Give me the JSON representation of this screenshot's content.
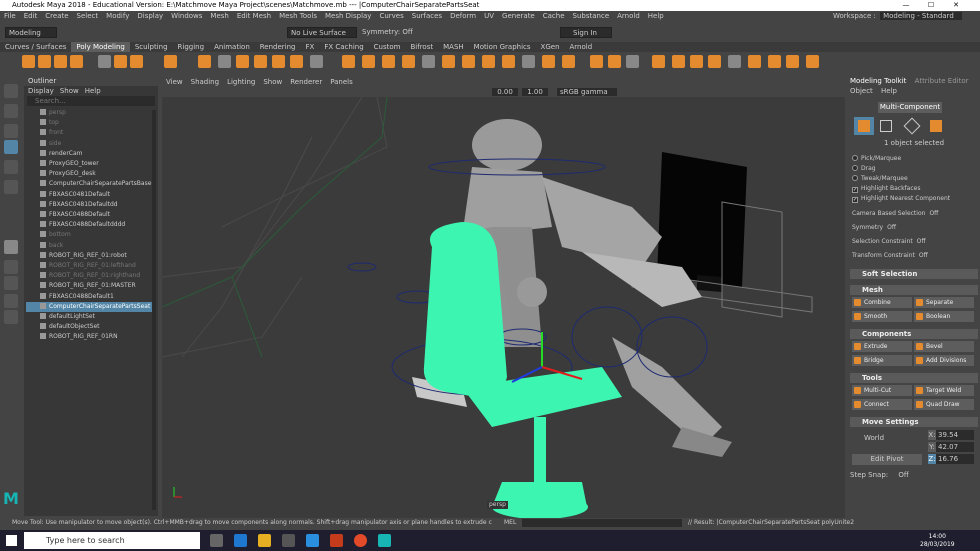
{
  "title": "Autodesk Maya 2018 - Educational Version: E:\\Matchmove Maya Project\\scenes\\Matchmove.mb  ---  |ComputerChairSeparatePartsSeat",
  "window_controls": [
    "—",
    "☐",
    "✕"
  ],
  "menus": [
    "File",
    "Edit",
    "Create",
    "Select",
    "Modify",
    "Display",
    "Windows",
    "Mesh",
    "Edit Mesh",
    "Mesh Tools",
    "Mesh Display",
    "Curves",
    "Surfaces",
    "Deform",
    "UV",
    "Generate",
    "Cache",
    "Substance",
    "Arnold",
    "Help"
  ],
  "workspace_label": "Workspace :",
  "workspace_value": "Modeling - Standard",
  "menuset": "Modeling",
  "live_surface": "No Live Surface",
  "symmetry": "Symmetry: Off",
  "sign_in": "Sign In",
  "shelf_tabs": [
    "Curves / Surfaces",
    "Poly Modeling",
    "Sculpting",
    "Rigging",
    "Animation",
    "Rendering",
    "FX",
    "FX Caching",
    "Custom",
    "Bifrost",
    "MASH",
    "Motion Graphics",
    "XGen",
    "Arnold"
  ],
  "shelf_active": "Poly Modeling",
  "outliner": {
    "title": "Outliner",
    "menu": [
      "Display",
      "Show",
      "Help"
    ],
    "search_placeholder": "Search...",
    "items": [
      {
        "label": "persp",
        "dim": true
      },
      {
        "label": "top",
        "dim": true
      },
      {
        "label": "front",
        "dim": true
      },
      {
        "label": "side",
        "dim": true
      },
      {
        "label": "renderCam",
        "dim": false
      },
      {
        "label": "ProxyGEO_tower",
        "dim": false
      },
      {
        "label": "ProxyGEO_desk",
        "dim": false
      },
      {
        "label": "ComputerChairSeparatePartsBase",
        "dim": false
      },
      {
        "label": "FBXASC0481Default",
        "dim": false
      },
      {
        "label": "FBXASC0481Defaultdd",
        "dim": false
      },
      {
        "label": "FBXASC0488Default",
        "dim": false
      },
      {
        "label": "FBXASC0488Defaultdddd",
        "dim": false
      },
      {
        "label": "bottom",
        "dim": true
      },
      {
        "label": "back",
        "dim": true
      },
      {
        "label": "ROBOT_RIG_REF_01:robot",
        "dim": false
      },
      {
        "label": "ROBOT_RIG_REF_01:lefthand",
        "dim": true
      },
      {
        "label": "ROBOT_RIG_REF_01:righthand",
        "dim": true
      },
      {
        "label": "ROBOT_RIG_REF_01:MASTER",
        "dim": false
      },
      {
        "label": "FBXASC0488Default1",
        "dim": false
      },
      {
        "label": "ComputerChairSeparatePartsSeat",
        "dim": false,
        "selected": true
      },
      {
        "label": "defaultLightSet",
        "dim": false
      },
      {
        "label": "defaultObjectSet",
        "dim": false
      },
      {
        "label": "ROBOT_RIG_REF_01RN",
        "dim": false
      }
    ]
  },
  "viewport": {
    "menu": [
      "View",
      "Shading",
      "Lighting",
      "Show",
      "Renderer",
      "Panels"
    ],
    "val1": "0.00",
    "val2": "1.00",
    "colorspace": "sRGB gamma",
    "camera_label": "persp"
  },
  "toolkit": {
    "tabs": [
      "Modeling Toolkit",
      "Attribute Editor"
    ],
    "menu": [
      "Object",
      "Help"
    ],
    "mode": "Multi-Component",
    "selected_info": "1 object selected",
    "options": [
      {
        "label": "Pick/Marquee",
        "type": "radio"
      },
      {
        "label": "Drag",
        "type": "radio"
      },
      {
        "label": "Tweak/Marquee",
        "type": "radio"
      },
      {
        "label": "Highlight Backfaces",
        "type": "check"
      },
      {
        "label": "Highlight Nearest Component",
        "type": "check"
      }
    ],
    "settings": [
      {
        "label": "Camera Based Selection",
        "value": "Off"
      },
      {
        "label": "Symmetry",
        "value": "Off"
      },
      {
        "label": "Selection Constraint",
        "value": "Off"
      },
      {
        "label": "Transform Constraint",
        "value": "Off"
      }
    ],
    "soft_selection": "Soft Selection",
    "mesh_header": "Mesh",
    "mesh_buttons": [
      "Combine",
      "Separate",
      "Smooth",
      "Boolean"
    ],
    "components_header": "Components",
    "component_buttons": [
      "Extrude",
      "Bevel",
      "Bridge",
      "Add Divisions"
    ],
    "tools_header": "Tools",
    "tool_buttons": [
      "Multi-Cut",
      "Target Weld",
      "Connect",
      "Quad Draw"
    ],
    "move_header": "Move Settings",
    "move_space": "World",
    "xyz": {
      "x": "39.54",
      "y": "42.07",
      "z": "16.76"
    },
    "edit_pivot": "Edit Pivot",
    "step_snap": "Step Snap:",
    "step_snap_value": "Off"
  },
  "status": {
    "help": "Move Tool: Use manipulator to move object(s). Ctrl+MMB+drag to move components along normals. Shift+drag manipulator axis or plane handles to extrude components or clone objects. Ctrl+Shift+LMB+drag to constrain",
    "mel": "MEL",
    "result": "// Result: |ComputerChairSeparatePartsSeat polyUnite2"
  },
  "taskbar": {
    "search": "Type here to search",
    "time": "14:00",
    "date": "28/03/2019"
  },
  "colors": {
    "accent": "#5285a6",
    "orange": "#e38b2e",
    "chair": "#3cf5b0",
    "logo_teal": "#18b5b5"
  }
}
